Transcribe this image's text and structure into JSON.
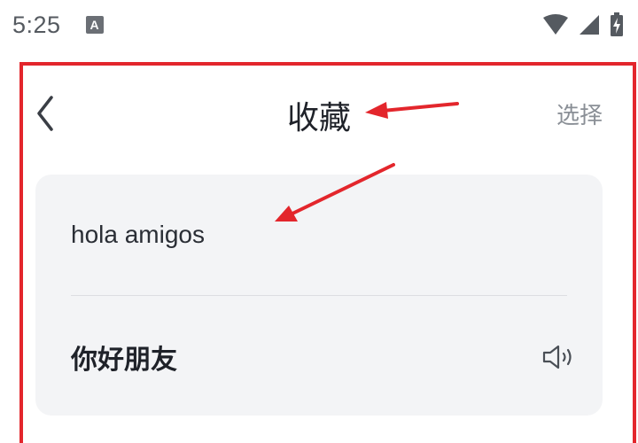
{
  "status_bar": {
    "time": "5:25",
    "notification_icon_letter": "A"
  },
  "nav": {
    "title": "收藏",
    "select_label": "选择"
  },
  "favorites": [
    {
      "source_text": "hola amigos",
      "translation": "你好朋友"
    }
  ],
  "colors": {
    "annotation_red": "#e3262c",
    "card_background": "#f3f4f6"
  }
}
